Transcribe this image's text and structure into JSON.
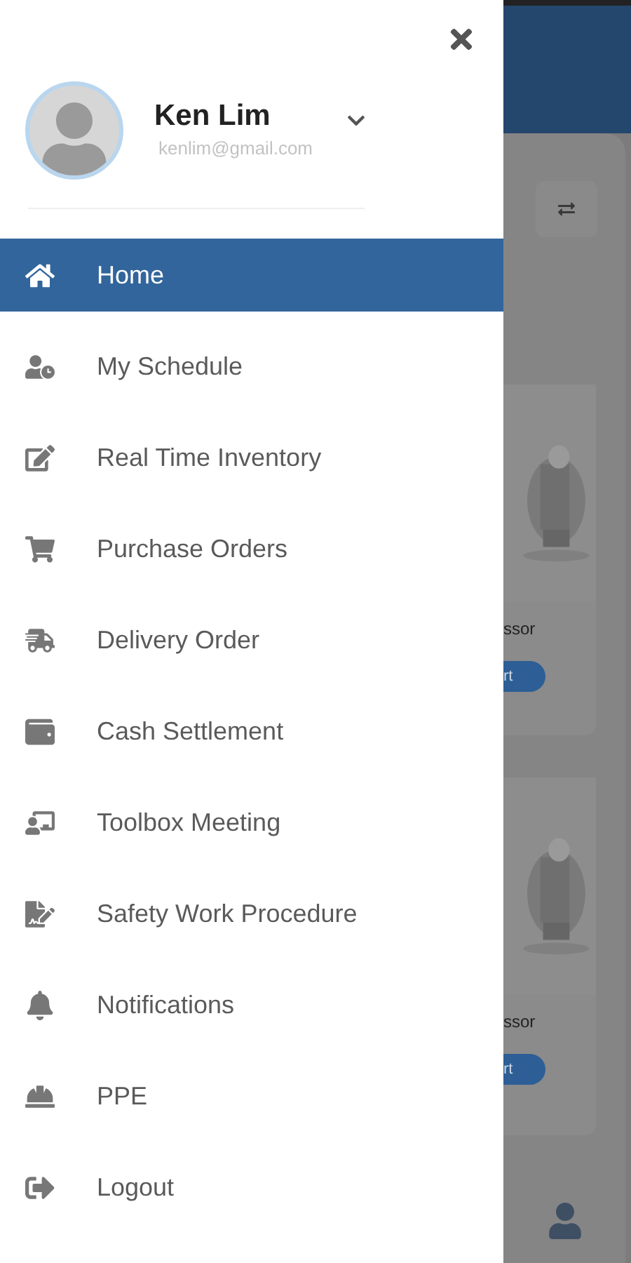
{
  "drawer": {
    "profile": {
      "name": "Ken Lim",
      "email": "kenlim@gmail.com"
    },
    "menu": [
      {
        "label": "Home",
        "selected": true
      },
      {
        "label": "My Schedule",
        "selected": false
      },
      {
        "label": "Real Time Inventory",
        "selected": false
      },
      {
        "label": "Purchase Orders",
        "selected": false
      },
      {
        "label": "Delivery Order",
        "selected": false
      },
      {
        "label": "Cash Settlement",
        "selected": false
      },
      {
        "label": "Toolbox Meeting",
        "selected": false
      },
      {
        "label": "Safety Work Procedure",
        "selected": false
      },
      {
        "label": "Notifications",
        "selected": false
      },
      {
        "label": "PPE",
        "selected": false
      },
      {
        "label": "Logout",
        "selected": false
      }
    ]
  },
  "background": {
    "cards": [
      {
        "title": "ssor",
        "button": "rt"
      },
      {
        "title": "ssor",
        "button": "rt"
      }
    ]
  }
}
